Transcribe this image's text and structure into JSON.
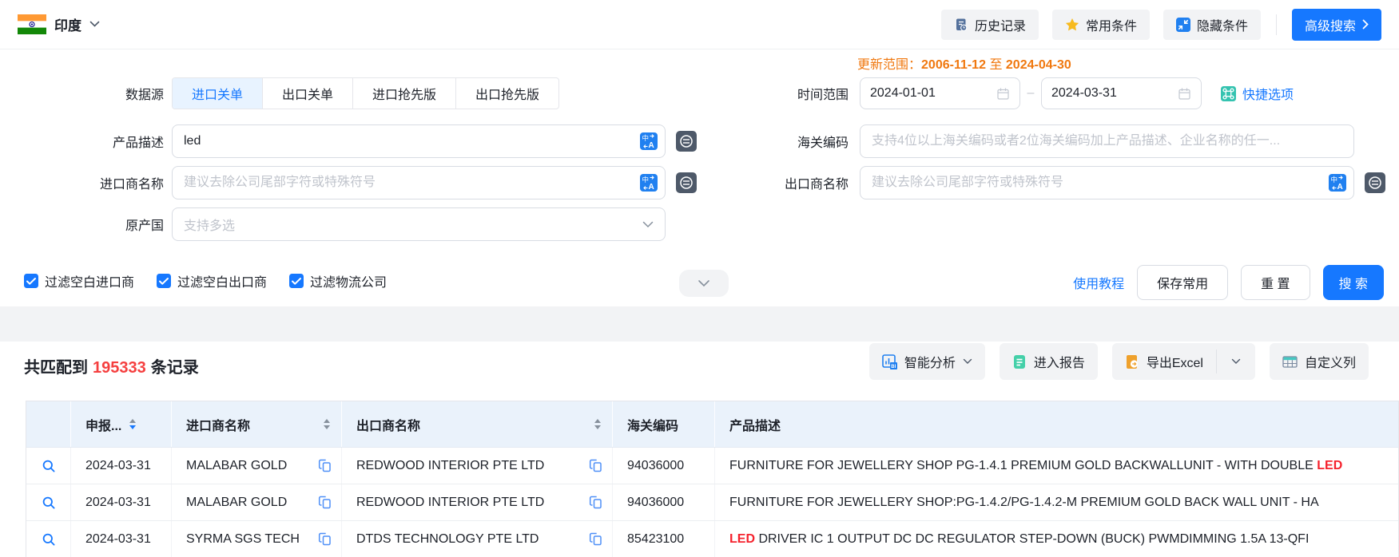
{
  "header": {
    "country": "印度",
    "buttons": {
      "history": "历史记录",
      "favorites": "常用条件",
      "hide": "隐藏条件",
      "advanced": "高级搜索"
    }
  },
  "form": {
    "update_range": {
      "label": "更新范围：",
      "start": "2006-11-12",
      "to": "至",
      "end": "2024-04-30"
    },
    "data_source": {
      "label": "数据源",
      "tabs": [
        {
          "label": "进口关单",
          "active": true
        },
        {
          "label": "出口关单",
          "active": false
        },
        {
          "label": "进口抢先版",
          "active": false
        },
        {
          "label": "出口抢先版",
          "active": false
        }
      ]
    },
    "time_range": {
      "label": "时间范围",
      "start": "2024-01-01",
      "end": "2024-03-31",
      "separator": "–",
      "shortcut": "快捷选项"
    },
    "product_desc": {
      "label": "产品描述",
      "value": "led"
    },
    "hs_code": {
      "label": "海关编码",
      "placeholder": "支持4位以上海关编码或者2位海关编码加上产品描述、企业名称的任一..."
    },
    "importer": {
      "label": "进口商名称",
      "placeholder": "建议去除公司尾部字符或特殊符号"
    },
    "exporter": {
      "label": "出口商名称",
      "placeholder": "建议去除公司尾部字符或特殊符号"
    },
    "origin": {
      "label": "原产国",
      "placeholder": "支持多选"
    },
    "filters": [
      {
        "label": "过滤空白进口商",
        "checked": true
      },
      {
        "label": "过滤空白出口商",
        "checked": true
      },
      {
        "label": "过滤物流公司",
        "checked": true
      }
    ],
    "actions": {
      "tutorial": "使用教程",
      "save": "保存常用",
      "reset": "重 置",
      "search": "搜 索"
    }
  },
  "results": {
    "summary": {
      "prefix": "共匹配到",
      "count": "195333",
      "suffix": "条记录"
    },
    "toolbar": {
      "analysis": "智能分析",
      "report": "进入报告",
      "export": "导出Excel",
      "columns": "自定义列"
    },
    "table": {
      "headers": {
        "date": "申报...",
        "importer": "进口商名称",
        "exporter": "出口商名称",
        "hs": "海关编码",
        "desc": "产品描述"
      },
      "rows": [
        {
          "date": "2024-03-31",
          "importer": "MALABAR GOLD",
          "exporter": "REDWOOD INTERIOR PTE LTD",
          "hs": "94036000",
          "desc_pre": "FURNITURE FOR JEWELLERY SHOP PG-1.4.1 PREMIUM GOLD BACKWALLUNIT - WITH DOUBLE ",
          "desc_hl": "LED",
          "desc_post": ""
        },
        {
          "date": "2024-03-31",
          "importer": "MALABAR GOLD",
          "exporter": "REDWOOD INTERIOR PTE LTD",
          "hs": "94036000",
          "desc_pre": "FURNITURE FOR JEWELLERY SHOP:PG-1.4.2/PG-1.4.2-M PREMIUM GOLD BACK WALL UNIT - HA",
          "desc_hl": "",
          "desc_post": ""
        },
        {
          "date": "2024-03-31",
          "importer": "SYRMA SGS TECH",
          "exporter": "DTDS TECHNOLOGY PTE LTD",
          "hs": "85423100",
          "desc_pre": "",
          "desc_hl": "LED",
          "desc_post": " DRIVER IC 1 OUTPUT DC DC REGULATOR STEP-DOWN (BUCK) PWMDIMMING 1.5A 13-QFI"
        }
      ]
    }
  },
  "colors": {
    "accent": "#1678ff",
    "orange": "#f0780f",
    "count_red": "#f53f3f",
    "highlight_red": "#f5222d"
  }
}
